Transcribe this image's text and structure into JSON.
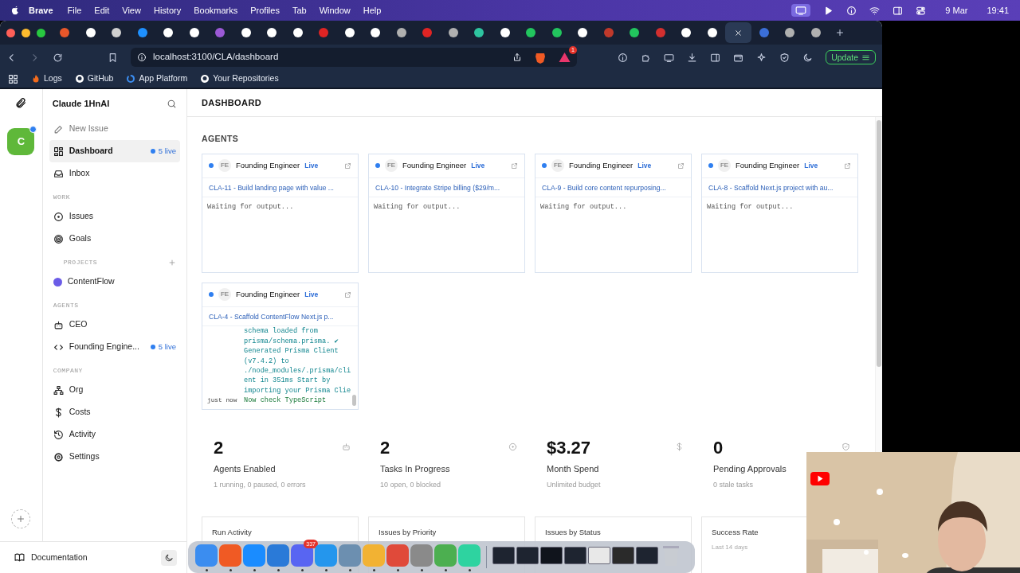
{
  "menubar": {
    "app": "Brave",
    "menus": [
      "File",
      "Edit",
      "View",
      "History",
      "Bookmarks",
      "Profiles",
      "Tab",
      "Window",
      "Help"
    ],
    "date": "9 Mar",
    "time": "19:41"
  },
  "browser_tabs": [
    {
      "color": "#e8572a",
      "selected": false
    },
    {
      "color": "#ffffff",
      "selected": false
    },
    {
      "color": "#d0d0d0",
      "selected": false
    },
    {
      "color": "#1e90ff",
      "selected": false
    },
    {
      "color": "#ffffff",
      "selected": false
    },
    {
      "color": "#ffffff",
      "selected": false
    },
    {
      "color": "#9b59d6",
      "selected": false
    },
    {
      "color": "#ffffff",
      "selected": false
    },
    {
      "color": "#ffffff",
      "selected": false
    },
    {
      "color": "#ffffff",
      "selected": false
    },
    {
      "color": "#e02424",
      "selected": false
    },
    {
      "color": "#ffffff",
      "selected": false
    },
    {
      "color": "#ffffff",
      "selected": false
    },
    {
      "color": "#b0b0b0",
      "selected": false
    },
    {
      "color": "#e02424",
      "selected": false
    },
    {
      "color": "#b0b0b0",
      "selected": false
    },
    {
      "color": "#2ec4a0",
      "selected": false
    },
    {
      "color": "#ffffff",
      "selected": false
    },
    {
      "color": "#22c55e",
      "selected": false
    },
    {
      "color": "#22c55e",
      "selected": false
    },
    {
      "color": "#ffffff",
      "selected": false
    },
    {
      "color": "#c0392b",
      "selected": false
    },
    {
      "color": "#22c55e",
      "selected": false
    },
    {
      "color": "#d32f2f",
      "selected": false
    },
    {
      "color": "#ffffff",
      "selected": false
    },
    {
      "color": "#ffffff",
      "selected": false
    },
    {
      "selected": true
    },
    {
      "color": "#3b6fd8",
      "selected": false
    },
    {
      "color": "#b0b0b0",
      "selected": false
    },
    {
      "color": "#b0b0b0",
      "selected": false
    }
  ],
  "toolbar": {
    "url": "localhost:3100/CLA/dashboard",
    "alert_count": "1",
    "update_button": "Update"
  },
  "bookmarks": [
    "Logs",
    "GitHub",
    "App Platform",
    "Your Repositories"
  ],
  "rail": {
    "workspace_initial": "C",
    "notification": true
  },
  "sidebar": {
    "title": "Claude 1HnAI",
    "sections": [
      {
        "items": [
          {
            "kind": "action",
            "label": "New Issue",
            "selected": false
          },
          {
            "kind": "link",
            "label": "Dashboard",
            "selected": true,
            "badge": "5 live"
          },
          {
            "kind": "link",
            "label": "Inbox",
            "selected": false
          }
        ]
      },
      {
        "heading": "WORK",
        "items": [
          {
            "kind": "link",
            "label": "Issues",
            "selected": false
          },
          {
            "kind": "link",
            "label": "Goals",
            "selected": false
          }
        ]
      },
      {
        "heading": "PROJECTS",
        "addable": true,
        "items": [
          {
            "kind": "project",
            "label": "ContentFlow",
            "selected": false,
            "color": "#6b5ce7"
          }
        ]
      },
      {
        "heading": "AGENTS",
        "items": [
          {
            "kind": "link",
            "label": "CEO",
            "selected": false
          },
          {
            "kind": "link",
            "label": "Founding Engine...",
            "selected": false,
            "badge": "5 live"
          }
        ]
      },
      {
        "heading": "COMPANY",
        "items": [
          {
            "kind": "link",
            "label": "Org",
            "selected": false
          },
          {
            "kind": "link",
            "label": "Costs",
            "selected": false
          },
          {
            "kind": "link",
            "label": "Activity",
            "selected": false
          },
          {
            "kind": "link",
            "label": "Settings",
            "selected": false
          }
        ]
      }
    ],
    "footer": "Documentation"
  },
  "page_title": "DASHBOARD",
  "agents_heading": "AGENTS",
  "agents": [
    {
      "kind": "waiting",
      "live": true,
      "initials": "FE",
      "name": "Founding Engineer",
      "status": "Live",
      "issue": "CLA-11 - Build landing page with value ...",
      "output": "Waiting for output..."
    },
    {
      "kind": "waiting",
      "live": true,
      "initials": "FE",
      "name": "Founding Engineer",
      "status": "Live",
      "issue": "CLA-10 - Integrate Stripe billing ($29/m...",
      "output": "Waiting for output..."
    },
    {
      "kind": "waiting",
      "live": true,
      "initials": "FE",
      "name": "Founding Engineer",
      "status": "Live",
      "issue": "CLA-9 - Build core content repurposing...",
      "output": "Waiting for output..."
    },
    {
      "kind": "waiting",
      "live": true,
      "initials": "FE",
      "name": "Founding Engineer",
      "status": "Live",
      "issue": "CLA-8 - Scaffold Next.js project with au...",
      "output": "Waiting for output..."
    },
    {
      "kind": "log",
      "live": true,
      "initials": "FE",
      "name": "Founding Engineer",
      "status": "Live",
      "issue": "CLA-4 - Scaffold ContentFlow Next.js p...",
      "log": [
        {
          "text": "schema loaded from prisma/schema.prisma. ✔ Generated Prisma Client (v7.4.2) to ./node_modules/.prisma/client in 351ms Start by importing your Prisma Clie"
        },
        {
          "time": "just now",
          "text": "Now check TypeScript"
        }
      ]
    }
  ],
  "stats": [
    {
      "value": "2",
      "label": "Agents Enabled",
      "detail": "1 running, 0 paused, 0 errors"
    },
    {
      "value": "2",
      "label": "Tasks In Progress",
      "detail": "10 open, 0 blocked"
    },
    {
      "value": "$3.27",
      "label": "Month Spend",
      "detail": "Unlimited budget"
    },
    {
      "value": "0",
      "label": "Pending Approvals",
      "detail": "0 stale tasks"
    }
  ],
  "chart_cards": [
    {
      "title": "Run Activity"
    },
    {
      "title": "Issues by Priority"
    },
    {
      "title": "Issues by Status"
    },
    {
      "title": "Success Rate",
      "subtitle": "Last 14 days"
    }
  ],
  "dock": {
    "badge": "337",
    "apps": [
      {
        "kind": "app",
        "color": "#3b8df0",
        "running": true
      },
      {
        "kind": "app",
        "color": "#f05a24",
        "running": true
      },
      {
        "kind": "app",
        "color": "#1a8cff",
        "running": true
      },
      {
        "kind": "app",
        "color": "#2a7ad8",
        "running": true
      },
      {
        "kind": "app",
        "color": "#5865f2",
        "running": true
      },
      {
        "kind": "app",
        "color": "#2496ed",
        "running": true
      },
      {
        "kind": "app",
        "color": "#6c8fb0",
        "running": true
      },
      {
        "kind": "app",
        "color": "#f2b233",
        "running": true
      },
      {
        "kind": "app",
        "color": "#e04a3a",
        "running": true
      },
      {
        "kind": "app",
        "color": "#8a8a8a",
        "running": true
      },
      {
        "kind": "app",
        "color": "#4caf50",
        "running": true
      },
      {
        "kind": "app",
        "color": "#2ed3a0",
        "running": true
      },
      {
        "kind": "window",
        "color": "#1e2430",
        "running": false
      },
      {
        "kind": "window",
        "color": "#1e2430",
        "running": false
      },
      {
        "kind": "window",
        "color": "#10141c",
        "running": false
      },
      {
        "kind": "window",
        "color": "#1e2430",
        "running": false
      },
      {
        "kind": "window",
        "color": "#e8e8e8",
        "running": false
      },
      {
        "kind": "window",
        "color": "#2a2a2a",
        "running": false
      },
      {
        "kind": "window",
        "color": "#1e2430",
        "running": false
      },
      {
        "kind": "trash",
        "color": "#c8ccd2",
        "running": false
      }
    ]
  },
  "webcam": {
    "kind": "picture"
  }
}
